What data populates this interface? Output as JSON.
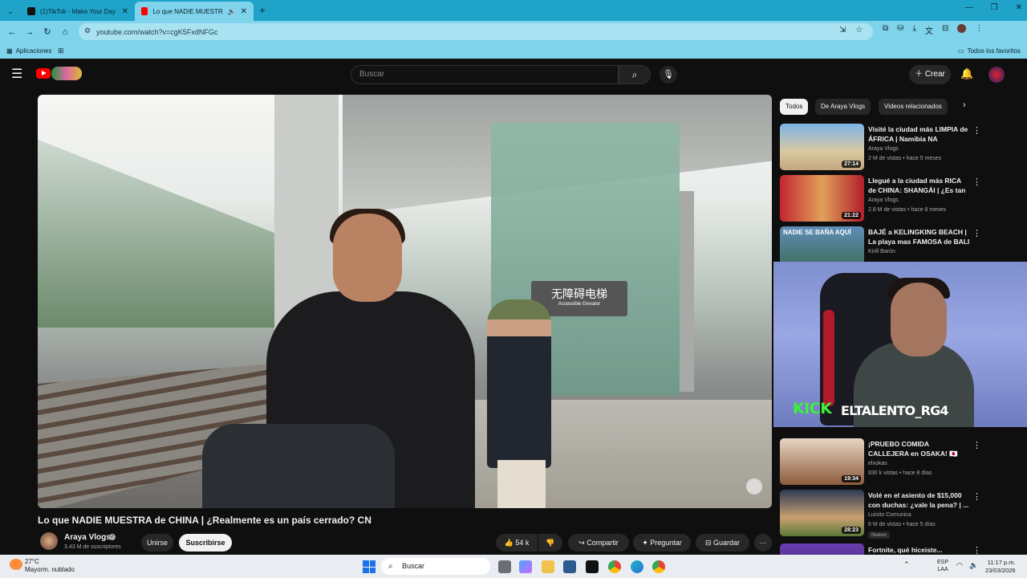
{
  "browser": {
    "tabs": [
      {
        "label": "(1)TikTok - Make Your Day",
        "active": false,
        "favicon": "tiktok-icon"
      },
      {
        "label": "Lo que NADIE MUESTRA de",
        "active": true,
        "favicon": "youtube-icon"
      }
    ],
    "new_tab": "+",
    "url": "youtube.com/watch?v=cgK5FxdNFGc",
    "bookmarks": {
      "apps": "Aplicaciones",
      "all": "Todos los favoritos"
    }
  },
  "youtube": {
    "search_placeholder": "Buscar",
    "create_label": "Crear",
    "video": {
      "title": "Lo que NADIE MUESTRA de CHINA | ¿Realmente es un país cerrado? 🇨🇳",
      "title_text": "Lo que NADIE MUESTRA de CHINA | ¿Realmente es un país cerrado? CN",
      "sign_text": "无障碍电梯",
      "sign_sub": "Accessible Elevator"
    },
    "channel": {
      "name": "Araya Vlogs",
      "subscribers": "3.43 M de suscriptores"
    },
    "buttons": {
      "join": "Unirse",
      "subscribe": "Suscribirse",
      "likes": "54 k",
      "share": "Compartir",
      "ask": "Preguntar",
      "save": "Guardar"
    },
    "chips": [
      "Todos",
      "De Araya Vlogs",
      "Videos relacionados"
    ],
    "recommendations": [
      {
        "title": "Visité la ciudad más LIMPIA de ÁFRICA | Namibia NA",
        "channel": "Araya Vlogs",
        "meta": "2 M de vistas • hace 5 meses",
        "duration": "27:14",
        "verified": true
      },
      {
        "title": "Llegué a la ciudad más RICA de CHINA: SHANGÁI | ¿Es tan ...",
        "channel": "Araya Vlogs",
        "meta": "2.8 M de vistas • hace 8 meses",
        "duration": "21:22",
        "verified": true
      },
      {
        "title": "BAJÉ a KELINGKING BEACH | La playa mas FAMOSA de BALI",
        "channel": "Kirill Barón",
        "meta": "",
        "duration": "",
        "verified": false
      },
      {
        "title": "¡PRUEBO COMIDA CALLEJERA en OSAKA! 🇯🇵 Xokas en Japón",
        "channel": "elxokas",
        "meta": "830 k vistas • hace 8 días",
        "duration": "19:34",
        "verified": true
      },
      {
        "title": "Volé en el asiento de $15,000 con duchas: ¿vale la pena? | ...",
        "channel": "Luisito Comunica",
        "meta": "6 M de vistas • hace 5 días",
        "duration": "28:23",
        "verified": true,
        "badge": "Nuevo"
      },
      {
        "title": "Fortnite, qué hiceiste...",
        "channel": "",
        "meta": "",
        "duration": "",
        "verified": false
      }
    ]
  },
  "overlay": {
    "kick": "KICK",
    "username": "ELTALENTO_RG4",
    "thumb_text": "NADIE SE BAÑA AQUÍ"
  },
  "taskbar": {
    "temperature": "27°C",
    "condition": "Mayorm. nublado",
    "search": "Buscar",
    "lang_line1": "ESP",
    "lang_line2": "LAA",
    "time": "11:17 p.m.",
    "date": "23/03/2026"
  },
  "colors": {
    "accent_chrome": "#7fd3ea",
    "tabbar": "#1fa3c9",
    "yt_red": "#ff0000",
    "kick_green": "#3df03a"
  }
}
